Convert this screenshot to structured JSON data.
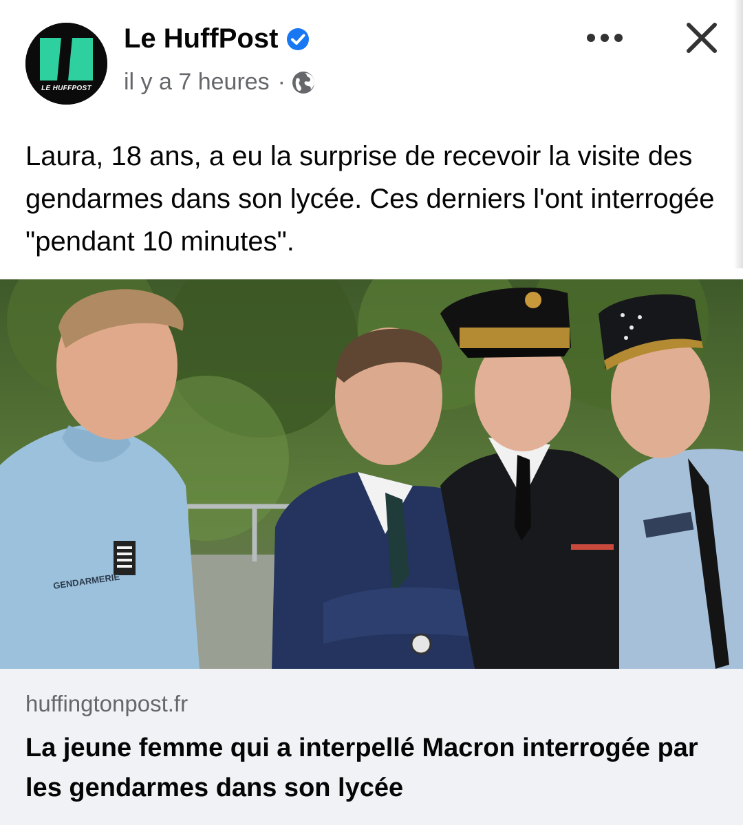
{
  "post": {
    "page_name": "Le HuffPost",
    "avatar_text": "LE HUFFPOST",
    "timestamp": "il y a 7 heures",
    "separator": "·",
    "audience_icon": "globe-icon",
    "verified_icon": "verified-badge-icon",
    "text": "Laura, 18 ans, a eu la surprise de recevoir la visite des gendarmes dans son lycée. Ces derniers l'ont interrogée \"pendant 10 minutes\".",
    "more_icon": "more-options-icon",
    "close_icon": "close-icon"
  },
  "link_preview": {
    "domain": "huffingtonpost.fr",
    "headline": "La jeune femme qui a interpellé Macron interrogée par les gendarmes dans son lycée",
    "photo_badge_text": "GENDARMERIE"
  },
  "colors": {
    "brand_green": "#2fd0a0",
    "verified_blue": "#1877f2",
    "secondary_text": "#65676b",
    "card_bg": "#f0f2f5"
  }
}
